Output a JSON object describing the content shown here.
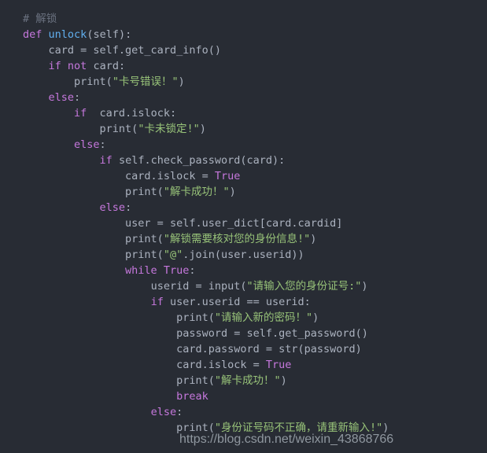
{
  "editor": {
    "language": "python",
    "background_color": "#282c34",
    "watermark": "https://blog.csdn.net/weixin_43868766",
    "colors": {
      "comment": "#6b7280",
      "keyword": "#c678dd",
      "function": "#61afef",
      "string": "#98c379",
      "plain": "#abb2bf"
    },
    "lines": [
      {
        "n": 1,
        "indent": 0,
        "text": "# 解锁",
        "tokens": [
          {
            "t": "# 解锁",
            "c": "comment"
          }
        ]
      },
      {
        "n": 2,
        "indent": 0,
        "text": "def unlock(self):",
        "tokens": [
          {
            "t": "def",
            "c": "keyword"
          },
          {
            "t": " ",
            "c": "plain"
          },
          {
            "t": "unlock",
            "c": "func"
          },
          {
            "t": "(self):",
            "c": "plain"
          }
        ]
      },
      {
        "n": 3,
        "indent": 1,
        "text": "card = self.get_card_info()",
        "tokens": [
          {
            "t": "card = self.get_card_info()",
            "c": "plain"
          }
        ]
      },
      {
        "n": 4,
        "indent": 1,
        "text": "if not card:",
        "tokens": [
          {
            "t": "if",
            "c": "keyword"
          },
          {
            "t": " ",
            "c": "plain"
          },
          {
            "t": "not",
            "c": "keyword"
          },
          {
            "t": " card:",
            "c": "plain"
          }
        ]
      },
      {
        "n": 5,
        "indent": 2,
        "text": "print(\"卡号错误！\")",
        "tokens": [
          {
            "t": "print(",
            "c": "plain"
          },
          {
            "t": "\"卡号错误！\"",
            "c": "string"
          },
          {
            "t": ")",
            "c": "plain"
          }
        ]
      },
      {
        "n": 6,
        "indent": 1,
        "text": "else:",
        "tokens": [
          {
            "t": "else",
            "c": "keyword"
          },
          {
            "t": ":",
            "c": "plain"
          }
        ]
      },
      {
        "n": 7,
        "indent": 2,
        "text": "if  card.islock:",
        "tokens": [
          {
            "t": "if",
            "c": "keyword"
          },
          {
            "t": "  card.islock:",
            "c": "plain"
          }
        ]
      },
      {
        "n": 8,
        "indent": 3,
        "text": "print(\"卡未锁定!\")",
        "tokens": [
          {
            "t": "print(",
            "c": "plain"
          },
          {
            "t": "\"卡未锁定!\"",
            "c": "string"
          },
          {
            "t": ")",
            "c": "plain"
          }
        ]
      },
      {
        "n": 9,
        "indent": 2,
        "text": "else:",
        "tokens": [
          {
            "t": "else",
            "c": "keyword"
          },
          {
            "t": ":",
            "c": "plain"
          }
        ]
      },
      {
        "n": 10,
        "indent": 3,
        "text": "if self.check_password(card):",
        "tokens": [
          {
            "t": "if",
            "c": "keyword"
          },
          {
            "t": " self.check_password(card):",
            "c": "plain"
          }
        ]
      },
      {
        "n": 11,
        "indent": 4,
        "text": "card.islock = True",
        "tokens": [
          {
            "t": "card.islock = ",
            "c": "plain"
          },
          {
            "t": "True",
            "c": "builtin"
          }
        ]
      },
      {
        "n": 12,
        "indent": 4,
        "text": "print(\"解卡成功！\")",
        "tokens": [
          {
            "t": "print(",
            "c": "plain"
          },
          {
            "t": "\"解卡成功！\"",
            "c": "string"
          },
          {
            "t": ")",
            "c": "plain"
          }
        ]
      },
      {
        "n": 13,
        "indent": 3,
        "text": "else:",
        "tokens": [
          {
            "t": "else",
            "c": "keyword"
          },
          {
            "t": ":",
            "c": "plain"
          }
        ]
      },
      {
        "n": 14,
        "indent": 4,
        "text": "user = self.user_dict[card.cardid]",
        "tokens": [
          {
            "t": "user = self.user_dict[card.cardid]",
            "c": "plain"
          }
        ]
      },
      {
        "n": 15,
        "indent": 4,
        "text": "print(\"解锁需要核对您的身份信息!\")",
        "tokens": [
          {
            "t": "print(",
            "c": "plain"
          },
          {
            "t": "\"解锁需要核对您的身份信息!\"",
            "c": "string"
          },
          {
            "t": ")",
            "c": "plain"
          }
        ]
      },
      {
        "n": 16,
        "indent": 4,
        "text": "print(\"@\".join(user.userid))",
        "tokens": [
          {
            "t": "print(",
            "c": "plain"
          },
          {
            "t": "\"@\"",
            "c": "string"
          },
          {
            "t": ".join(user.userid))",
            "c": "plain"
          }
        ]
      },
      {
        "n": 17,
        "indent": 4,
        "text": "while True:",
        "tokens": [
          {
            "t": "while",
            "c": "keyword"
          },
          {
            "t": " ",
            "c": "plain"
          },
          {
            "t": "True",
            "c": "builtin"
          },
          {
            "t": ":",
            "c": "plain"
          }
        ]
      },
      {
        "n": 18,
        "indent": 5,
        "text": "userid = input(\"请输入您的身份证号:\")",
        "tokens": [
          {
            "t": "userid = input(",
            "c": "plain"
          },
          {
            "t": "\"请输入您的身份证号:\"",
            "c": "string"
          },
          {
            "t": ")",
            "c": "plain"
          }
        ]
      },
      {
        "n": 19,
        "indent": 5,
        "text": "if user.userid == userid:",
        "tokens": [
          {
            "t": "if",
            "c": "keyword"
          },
          {
            "t": " user.userid == userid:",
            "c": "plain"
          }
        ]
      },
      {
        "n": 20,
        "indent": 6,
        "text": "print(\"请输入新的密码！\")",
        "tokens": [
          {
            "t": "print(",
            "c": "plain"
          },
          {
            "t": "\"请输入新的密码！\"",
            "c": "string"
          },
          {
            "t": ")",
            "c": "plain"
          }
        ]
      },
      {
        "n": 21,
        "indent": 6,
        "text": "password = self.get_password()",
        "tokens": [
          {
            "t": "password = self.get_password()",
            "c": "plain"
          }
        ]
      },
      {
        "n": 22,
        "indent": 6,
        "text": "card.password = str(password)",
        "tokens": [
          {
            "t": "card.password = str(password)",
            "c": "plain"
          }
        ]
      },
      {
        "n": 23,
        "indent": 6,
        "text": "card.islock = True",
        "tokens": [
          {
            "t": "card.islock = ",
            "c": "plain"
          },
          {
            "t": "True",
            "c": "builtin"
          }
        ]
      },
      {
        "n": 24,
        "indent": 6,
        "text": "print(\"解卡成功！\")",
        "tokens": [
          {
            "t": "print(",
            "c": "plain"
          },
          {
            "t": "\"解卡成功！\"",
            "c": "string"
          },
          {
            "t": ")",
            "c": "plain"
          }
        ]
      },
      {
        "n": 25,
        "indent": 6,
        "text": "break",
        "tokens": [
          {
            "t": "break",
            "c": "keyword"
          }
        ]
      },
      {
        "n": 26,
        "indent": 5,
        "text": "else:",
        "tokens": [
          {
            "t": "else",
            "c": "keyword"
          },
          {
            "t": ":",
            "c": "plain"
          }
        ]
      },
      {
        "n": 27,
        "indent": 6,
        "text": "print(\"身份证号码不正确，请重新输入!\")",
        "tokens": [
          {
            "t": "print(",
            "c": "plain"
          },
          {
            "t": "\"身份证号码不正确，请重新输入!\"",
            "c": "string"
          },
          {
            "t": ")",
            "c": "plain"
          }
        ]
      }
    ]
  }
}
